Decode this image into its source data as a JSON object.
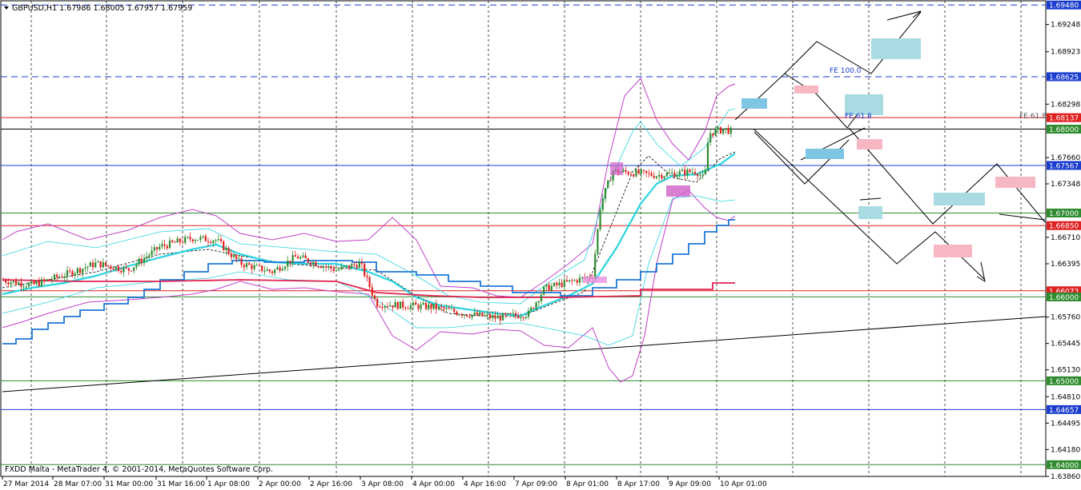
{
  "window": {
    "symbol_title": "GBPUSD,H1  1.67986 1.68005 1.67957 1.67959",
    "footer": "FXDD Malta - MetaTrader 4, © 2001-2014, MetaQuotes Software Corp."
  },
  "chart_data": {
    "type": "candlestick",
    "symbol": "GBPUSD",
    "timeframe": "H1",
    "ohlc_last": {
      "open": 1.67986,
      "high": 1.68005,
      "low": 1.67957,
      "close": 1.67959
    },
    "ylim": [
      1.6386,
      1.6953
    ],
    "y_ticks": [
      "1.69248",
      "1.68923",
      "1.68298",
      "1.67660",
      "1.67348",
      "1.66710",
      "1.66395",
      "1.65760",
      "1.65445",
      "1.65130",
      "1.64810",
      "1.64495",
      "1.64180",
      "1.63860"
    ],
    "x_ticks": [
      "27 Mar 2014",
      "28 Mar 07:00",
      "31 Mar 00:00",
      "31 Mar 16:00",
      "1 Apr 08:00",
      "2 Apr 00:00",
      "2 Apr 16:00",
      "3 Apr 08:00",
      "4 Apr 00:00",
      "4 Apr 16:00",
      "7 Apr 09:00",
      "8 Apr 01:00",
      "8 Apr 17:00",
      "9 Apr 09:00",
      "10 Apr 01:00"
    ],
    "price_labels": [
      {
        "text": "1.69480",
        "value": 1.6948,
        "bg": "#1a3ccf"
      },
      {
        "text": "1.68625",
        "value": 1.68625,
        "bg": "#1a3ccf"
      },
      {
        "text": "1.68137",
        "value": 1.68137,
        "bg": "#e02020"
      },
      {
        "text": "1.68000",
        "value": 1.68,
        "bg": "#2e8b2e"
      },
      {
        "text": "1.67567",
        "value": 1.67567,
        "bg": "#1a3ccf"
      },
      {
        "text": "1.67000",
        "value": 1.67,
        "bg": "#2e8b2e"
      },
      {
        "text": "1.66850",
        "value": 1.6685,
        "bg": "#e02020"
      },
      {
        "text": "1.66073",
        "value": 1.66073,
        "bg": "#e02020"
      },
      {
        "text": "1.66000",
        "value": 1.66,
        "bg": "#2e8b2e"
      },
      {
        "text": "1.64657",
        "value": 1.64657,
        "bg": "#1a3ccf"
      },
      {
        "text": "1.65000",
        "value": 1.65,
        "bg": "#2e8b2e"
      },
      {
        "text": "1.64000",
        "value": 1.64,
        "bg": "#2e8b2e"
      }
    ],
    "horizontal_levels": [
      {
        "value": 1.6948,
        "color": "#1a3ccf",
        "style": "dashed"
      },
      {
        "value": 1.68625,
        "color": "#1a3ccf",
        "style": "dashed"
      },
      {
        "value": 1.68137,
        "color": "#e02020",
        "style": "solid"
      },
      {
        "value": 1.68,
        "color": "#000000",
        "style": "solid"
      },
      {
        "value": 1.67567,
        "color": "#1a3ccf",
        "style": "solid"
      },
      {
        "value": 1.67,
        "color": "#2e8b2e",
        "style": "solid"
      },
      {
        "value": 1.6685,
        "color": "#e02020",
        "style": "solid"
      },
      {
        "value": 1.66073,
        "color": "#e02020",
        "style": "solid"
      },
      {
        "value": 1.66,
        "color": "#2e8b2e",
        "style": "solid"
      },
      {
        "value": 1.65,
        "color": "#2e8b2e",
        "style": "solid"
      },
      {
        "value": 1.64657,
        "color": "#1a3ccf",
        "style": "solid"
      },
      {
        "value": 1.64,
        "color": "#2e8b2e",
        "style": "solid"
      }
    ],
    "annotations": [
      {
        "text": "FE 100.0",
        "color": "#1a3ccf"
      },
      {
        "text": "FE 61.8",
        "color": "#1a3ccf"
      },
      {
        "text": "FE 61.8",
        "color": "#555555"
      }
    ],
    "grid": "vertical-dashed",
    "colors": {
      "bull": "#2e8b2e",
      "bear": "#e02020",
      "ma_cyan": "#2ad4e0",
      "stepped_blue": "#1e78d6",
      "bollinger": "#c040c8"
    }
  }
}
